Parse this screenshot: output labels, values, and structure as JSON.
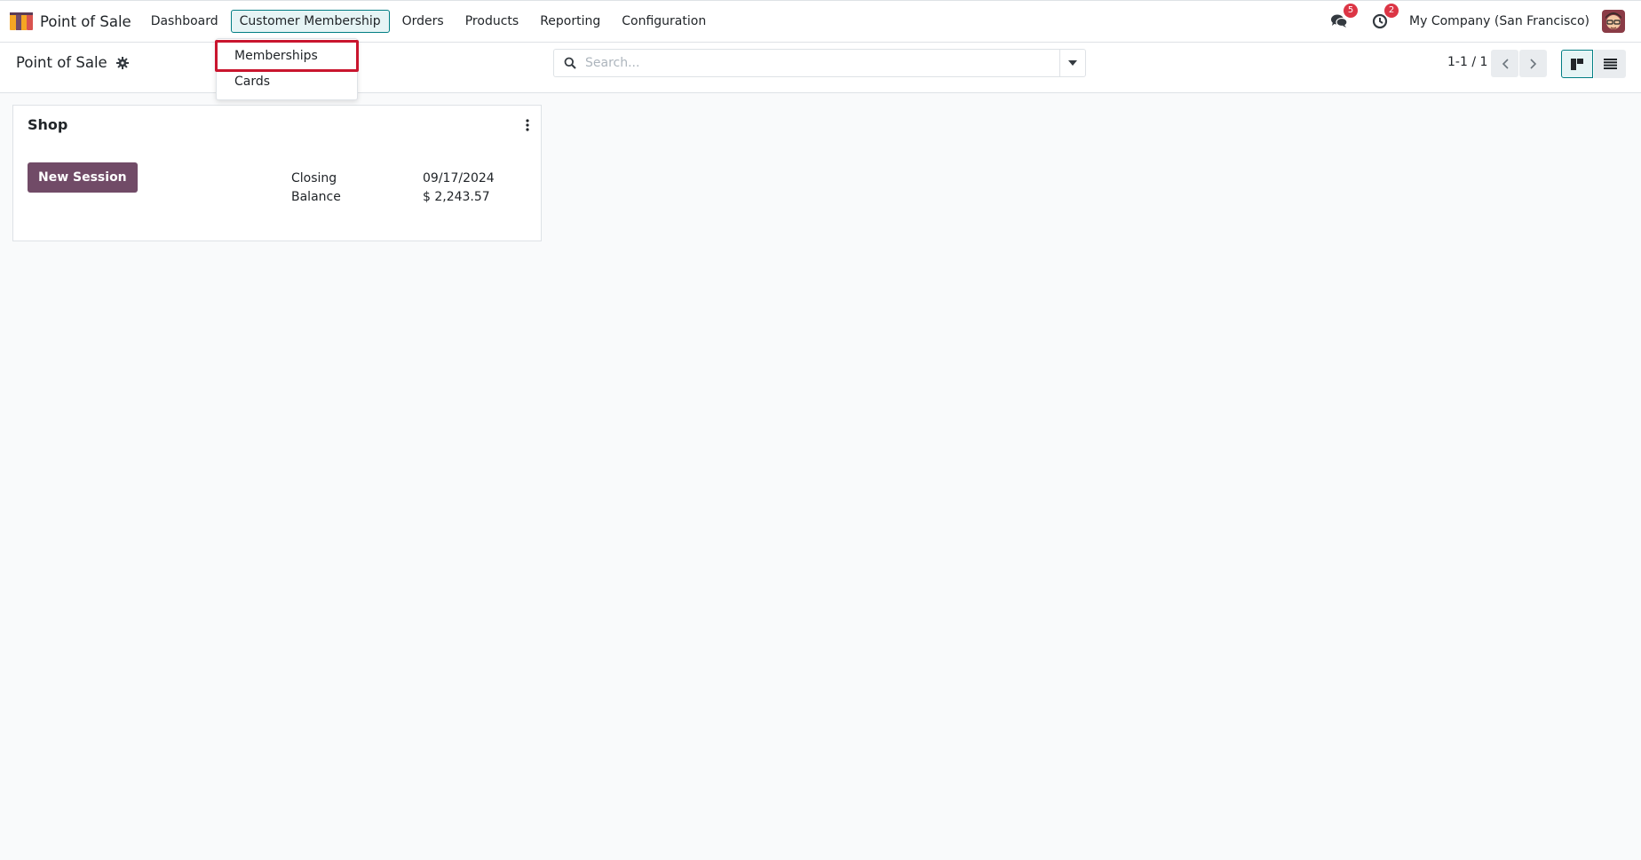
{
  "app": {
    "name": "Point of Sale"
  },
  "nav": {
    "menu": [
      {
        "label": "Dashboard"
      },
      {
        "label": "Customer Membership"
      },
      {
        "label": "Orders"
      },
      {
        "label": "Products"
      },
      {
        "label": "Reporting"
      },
      {
        "label": "Configuration"
      }
    ],
    "messages_count": "5",
    "activities_count": "2",
    "company": "My Company (San Francisco)"
  },
  "dropdown": {
    "items": [
      {
        "label": "Memberships"
      },
      {
        "label": "Cards"
      }
    ]
  },
  "control": {
    "title": "Point of Sale",
    "search_placeholder": "Search...",
    "pager": "1-1 / 1"
  },
  "card": {
    "title": "Shop",
    "button_label": "New Session",
    "closing_label": "Closing",
    "closing_value": "09/17/2024",
    "balance_label": "Balance",
    "balance_value": "$ 2,243.57"
  },
  "colors": {
    "brand": "#714b67",
    "accent": "#017e84",
    "badge": "#dc3545",
    "highlight_border": "#c9152e"
  },
  "icons": {
    "app_logo": "pos-awning-icon",
    "settings": "gear-icon",
    "search": "search-icon",
    "toggle": "caret-down-icon",
    "messages": "chat-bubbles-icon",
    "activities": "clock-icon",
    "prev": "chevron-left-icon",
    "next": "chevron-right-icon",
    "kanban": "kanban-view-icon",
    "list": "list-view-icon",
    "card_menu": "vertical-ellipsis-icon"
  }
}
